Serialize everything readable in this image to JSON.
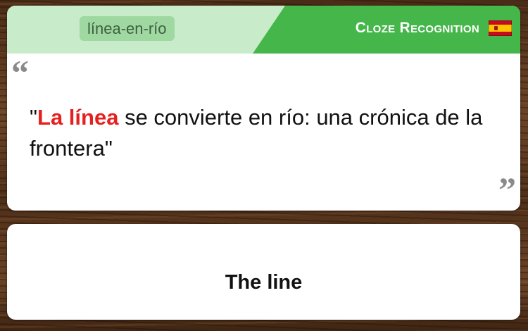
{
  "header": {
    "tag": "línea-en-río",
    "mode_label": "Cloze Recognition",
    "flag_icon": "spain-flag-icon"
  },
  "colors": {
    "header_light": "#c8ecc9",
    "header_green": "#45b649",
    "tag_pill": "#9fd8a1",
    "highlight": "#e61f1f"
  },
  "quote": {
    "open_mark": "“",
    "close_mark": "”",
    "prefix": "\"",
    "highlight": "La línea",
    "rest_line": " se convierte en río: una crónica de la frontera\""
  },
  "answer": {
    "text": "The line"
  }
}
